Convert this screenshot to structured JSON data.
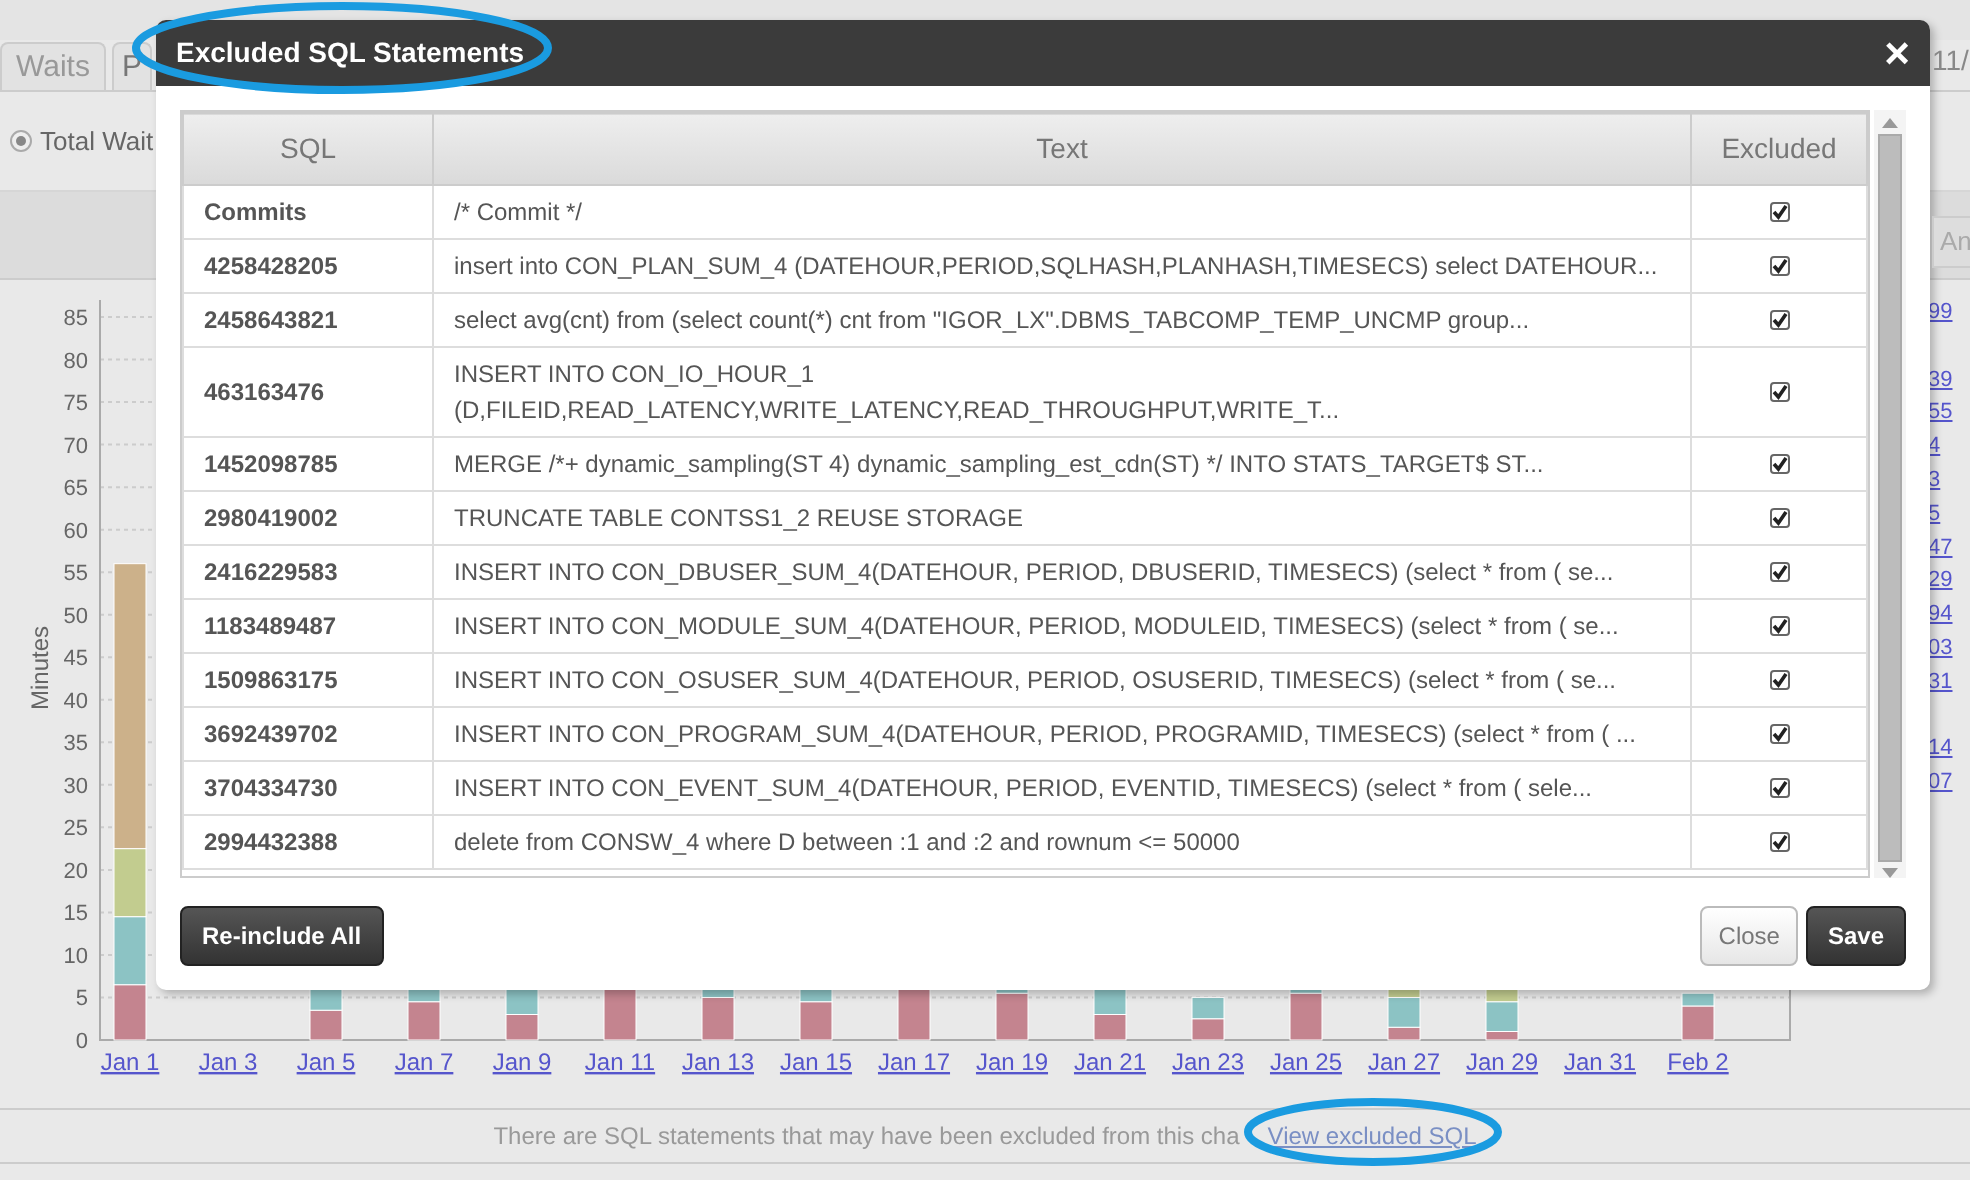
{
  "page": {
    "header_fragment": "11/",
    "tabs": [
      {
        "label": "Waits",
        "selected": false
      },
      {
        "label": "P",
        "selected": false
      }
    ],
    "radio": {
      "label": "Total Wait",
      "selected": true
    },
    "side_button": "An",
    "side_links": [
      "99",
      "39",
      "55",
      "4",
      "3",
      "5",
      "47",
      "29",
      "94",
      "03",
      "31",
      "14",
      "07"
    ],
    "chart": {
      "chart_data": {
        "type": "bar",
        "stacked": true,
        "grid": true,
        "ylabel": "Minutes",
        "yticks": [
          0,
          5,
          10,
          15,
          20,
          25,
          30,
          35,
          40,
          45,
          50,
          55,
          60,
          65,
          70,
          75,
          80,
          85
        ],
        "ylim": [
          0,
          87
        ],
        "categories": [
          "Jan 1",
          "Jan 3",
          "Jan 5",
          "Jan 7",
          "Jan 9",
          "Jan 11",
          "Jan 13",
          "Jan 15",
          "Jan 17",
          "Jan 19",
          "Jan 21",
          "Jan 23",
          "Jan 25",
          "Jan 27",
          "Jan 29",
          "Jan 31",
          "Feb 2"
        ],
        "series": [
          {
            "color": "#c4848f",
            "values": [
              6.5,
              0,
              3.5,
              4.5,
              3,
              6,
              5,
              4.5,
              6,
              5.5,
              3,
              2.5,
              5.5,
              1.5,
              1,
              0,
              4
            ]
          },
          {
            "color": "#8cc3c4",
            "values": [
              8,
              0,
              3,
              2,
              3,
              0,
              1,
              1.5,
              0,
              0.5,
              3,
              2.5,
              0.5,
              3.5,
              3.5,
              0,
              1.5
            ]
          },
          {
            "color": "#c2cc8f",
            "values": [
              8,
              0,
              0,
              0,
              0,
              0,
              0,
              0,
              0,
              0,
              0,
              0,
              0,
              1.5,
              1.5,
              0,
              0
            ]
          },
          {
            "color": "#ccb18a",
            "values": [
              33.5,
              0,
              0,
              0,
              0,
              0,
              0,
              0,
              0,
              0,
              0,
              0,
              0,
              0,
              0,
              0,
              0
            ]
          }
        ]
      }
    },
    "note": {
      "text": "There are SQL statements that may have been excluded from this cha",
      "link": "View excluded SQL",
      "highlighted": true
    }
  },
  "modal": {
    "title": "Excluded SQL Statements",
    "highlighted": true,
    "close": "×",
    "columns": [
      "SQL",
      "Text",
      "Excluded"
    ],
    "rows": [
      {
        "sql": "Commits",
        "text": "/* Commit */",
        "excluded": true
      },
      {
        "sql": "4258428205",
        "text": "insert into CON_PLAN_SUM_4 (DATEHOUR,PERIOD,SQLHASH,PLANHASH,TIMESECS) select DATEHOUR...",
        "excluded": true
      },
      {
        "sql": "2458643821",
        "text": "select avg(cnt) from (select count(*) cnt from \"IGOR_LX\".DBMS_TABCOMP_TEMP_UNCMP group...",
        "excluded": true
      },
      {
        "sql": "463163476",
        "text": "INSERT INTO CON_IO_HOUR_1 (D,FILEID,READ_LATENCY,WRITE_LATENCY,READ_THROUGHPUT,WRITE_T...",
        "excluded": true
      },
      {
        "sql": "1452098785",
        "text": "MERGE /*+ dynamic_sampling(ST 4) dynamic_sampling_est_cdn(ST) */ INTO STATS_TARGET$ ST...",
        "excluded": true
      },
      {
        "sql": "2980419002",
        "text": "TRUNCATE TABLE CONTSS1_2 REUSE STORAGE",
        "excluded": true
      },
      {
        "sql": "2416229583",
        "text": "INSERT INTO CON_DBUSER_SUM_4(DATEHOUR, PERIOD, DBUSERID, TIMESECS) (select * from ( se...",
        "excluded": true
      },
      {
        "sql": "1183489487",
        "text": "INSERT INTO CON_MODULE_SUM_4(DATEHOUR, PERIOD, MODULEID, TIMESECS) (select * from ( se...",
        "excluded": true
      },
      {
        "sql": "1509863175",
        "text": "INSERT INTO CON_OSUSER_SUM_4(DATEHOUR, PERIOD, OSUSERID, TIMESECS) (select * from ( se...",
        "excluded": true
      },
      {
        "sql": "3692439702",
        "text": "INSERT INTO CON_PROGRAM_SUM_4(DATEHOUR, PERIOD, PROGRAMID, TIMESECS) (select * from ( ...",
        "excluded": true
      },
      {
        "sql": "3704334730",
        "text": "INSERT INTO CON_EVENT_SUM_4(DATEHOUR, PERIOD, EVENTID, TIMESECS) (select * from ( sele...",
        "excluded": true
      },
      {
        "sql": "2994432388",
        "text": "delete from CONSW_4 where D between :1 and :2 and rownum <= 50000",
        "excluded": true
      }
    ],
    "buttons": {
      "reinclude": "Re-include All",
      "close": "Close",
      "save": "Save"
    }
  }
}
